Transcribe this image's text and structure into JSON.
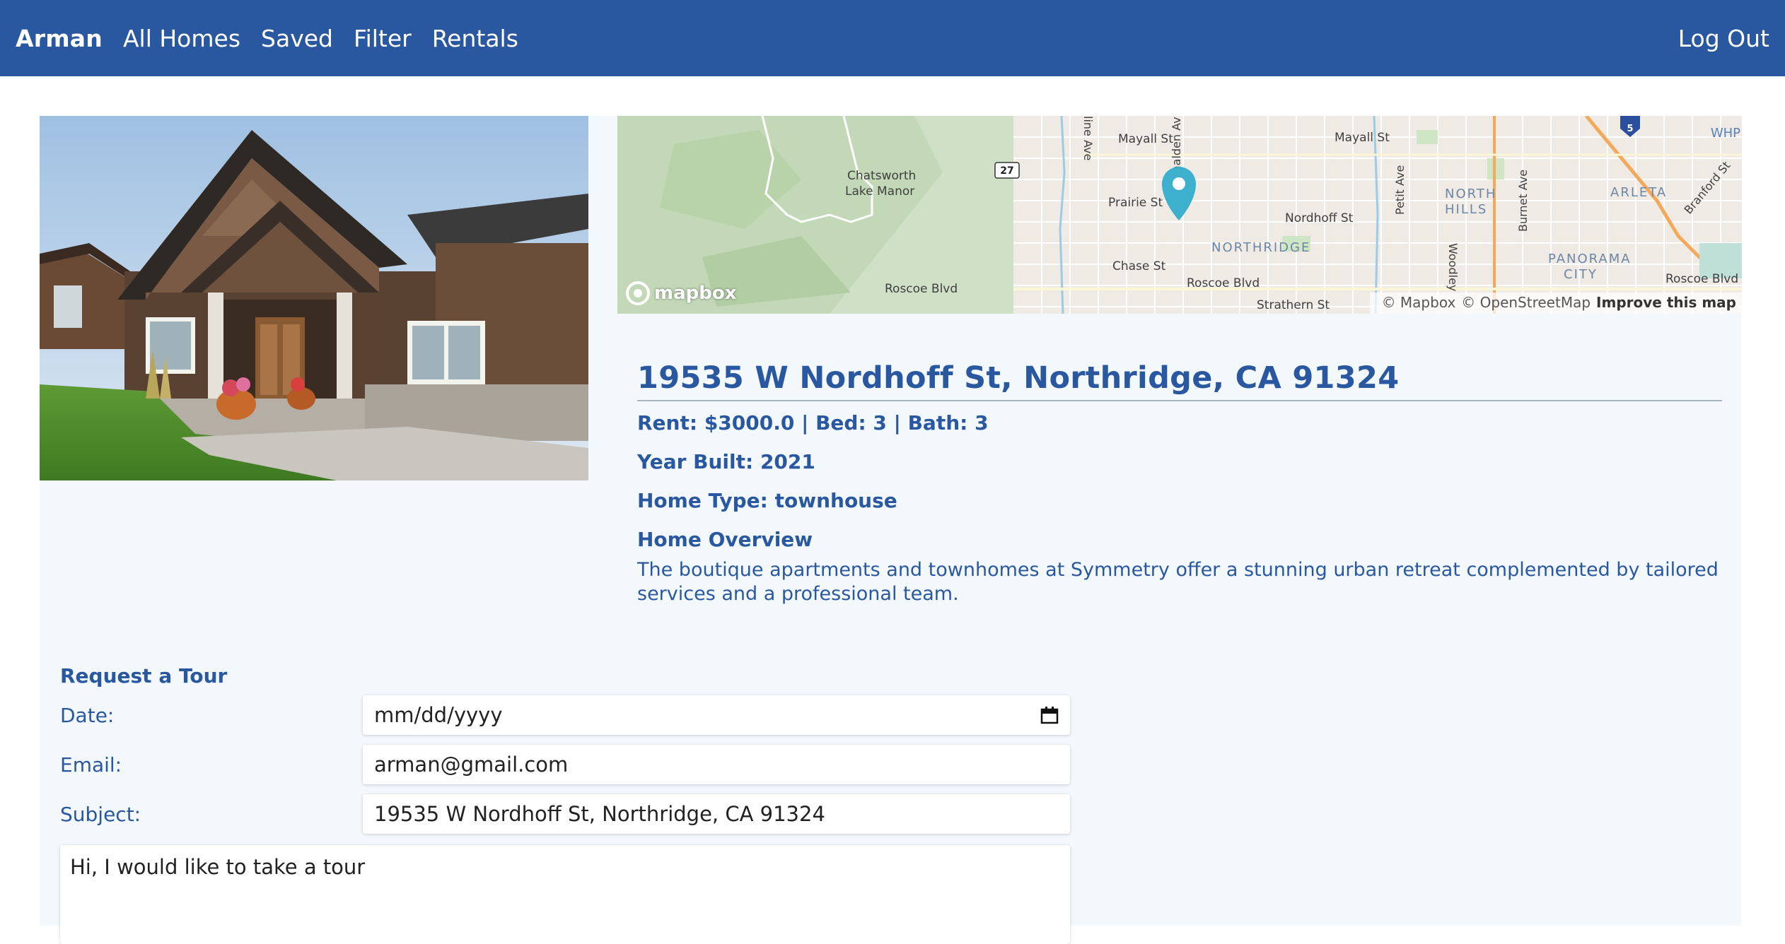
{
  "nav": {
    "brand": "Arman",
    "links": [
      "All Homes",
      "Saved",
      "Filter",
      "Rentals"
    ],
    "logout": "Log Out"
  },
  "map": {
    "labels": {
      "chatsworth": "Chatsworth\nLake Manor",
      "mayall1": "Mayall St",
      "mayall2": "Mayall St",
      "prairie": "Prairie St",
      "nordhoff": "Nordhoff St",
      "northridge": "NORTHRIDGE",
      "chase": "Chase St",
      "roscoe1": "Roscoe Blvd",
      "roscoe2": "Roscoe Blvd",
      "roscoe3": "Roscoe Blvd",
      "strathern": "Strathern St",
      "northhills": "NORTH\nHILLS",
      "arleta": "ARLETA",
      "panorama": "PANORAMA\nCITY",
      "whp": "WHP",
      "branford": "Branford St",
      "petit": "Petit Ave",
      "burnet": "Burnet Ave",
      "vanalden": "Vanalden Av",
      "woodley": "Woodley",
      "rte27": "27",
      "i5": "5",
      "lineave": "line Ave"
    },
    "logo": "mapbox",
    "attribution_mapbox": "© Mapbox",
    "attribution_osm": "© OpenStreetMap",
    "improve": "Improve this map"
  },
  "home": {
    "address": "19535 W Nordhoff St, Northridge, CA 91324",
    "summary": "Rent: $3000.0 | Bed: 3 | Bath: 3",
    "year_built": "Year Built: 2021",
    "home_type": "Home Type: townhouse",
    "overview_title": "Home Overview",
    "overview": "The boutique apartments and townhomes at Symmetry offer a stunning urban retreat complemented by tailored services and a professional team."
  },
  "tour": {
    "title": "Request a Tour",
    "date_label": "Date:",
    "date_value": "mm/dd/yyyy",
    "email_label": "Email:",
    "email_value": "arman@gmail.com",
    "subject_label": "Subject:",
    "subject_value": "19535 W Nordhoff St, Northridge, CA 91324",
    "message": "Hi, I would like to take a tour"
  },
  "colors": {
    "primary": "#2a58a0",
    "card_bg": "#f3f8fd",
    "map_pin": "#3cb0cc"
  }
}
